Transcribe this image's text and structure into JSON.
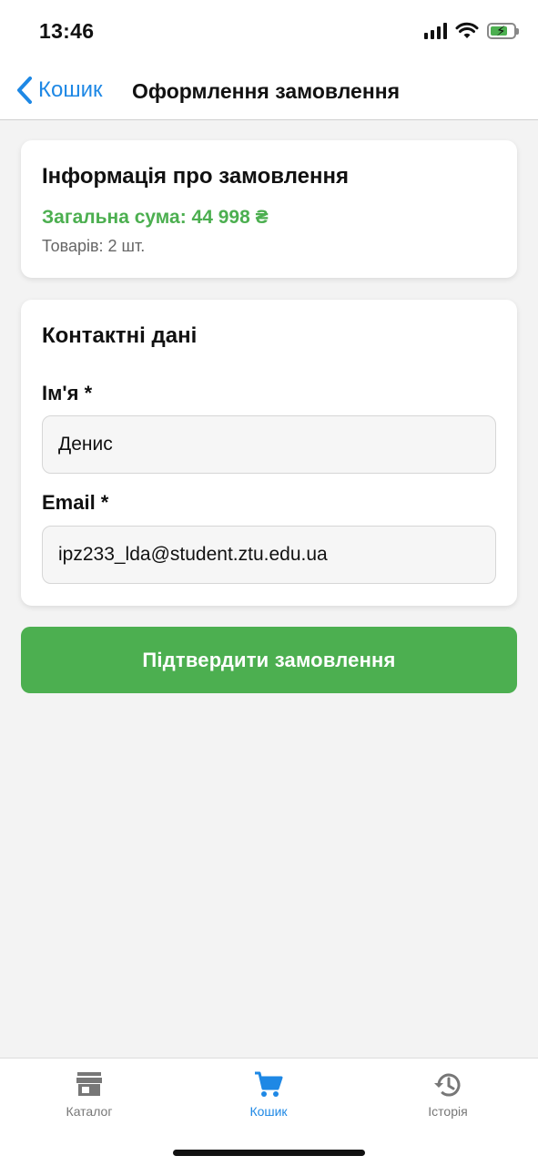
{
  "status_bar": {
    "time": "13:46",
    "battery_level": 0.75,
    "icons": [
      "signal-icon",
      "wifi-icon",
      "battery-charging-icon"
    ]
  },
  "header": {
    "back_label": "Кошик",
    "title": "Оформлення замовлення"
  },
  "order_info": {
    "title": "Інформація про замовлення",
    "total": "Загальна сума: 44 998 ₴",
    "items_count": "Товарів: 2 шт."
  },
  "contact": {
    "title": "Контактні дані",
    "name_label": "Ім'я *",
    "name_value": "Денис",
    "email_label": "Email *",
    "email_value": "ipz233_lda@student.ztu.edu.ua"
  },
  "confirm_button": {
    "label": "Підтвердити замовлення"
  },
  "tab_bar": {
    "tabs": [
      {
        "label": "Каталог",
        "icon": "store-icon",
        "active": false
      },
      {
        "label": "Кошик",
        "icon": "cart-icon",
        "active": true
      },
      {
        "label": "Історія",
        "icon": "history-icon",
        "active": false
      }
    ]
  },
  "colors": {
    "accent_blue": "#1e88e5",
    "success_green": "#4caf50",
    "background": "#f3f3f3"
  }
}
